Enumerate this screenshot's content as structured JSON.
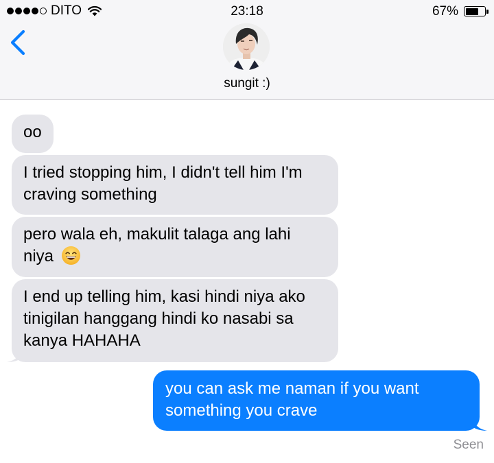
{
  "status_bar": {
    "carrier": "DITO",
    "time": "23:18",
    "battery_percent": "67%",
    "battery_level": 0.67,
    "signal_bars_filled": 4,
    "signal_bars_total": 5,
    "wifi_icon": "wifi-icon"
  },
  "header": {
    "back_icon": "chevron-left-icon",
    "contact_name": "sungit :)",
    "avatar_icon": "contact-avatar"
  },
  "messages": [
    {
      "direction": "incoming",
      "text": "oo"
    },
    {
      "direction": "incoming",
      "line1": "I tried stopping him, I didn't tell him I'm",
      "line2": "craving something"
    },
    {
      "direction": "incoming",
      "line1": "pero wala eh, makulit talaga ang lahi",
      "line2": "niya",
      "emoji": "grinning-face-with-smiling-eyes"
    },
    {
      "direction": "incoming",
      "line1": "I end up telling him, kasi hindi niya ako",
      "line2": "tinigilan hanggang hindi ko nasabi sa",
      "line3": "kanya HAHAHA"
    },
    {
      "direction": "outgoing",
      "line1": "you can ask me naman if you want",
      "line2": "something you crave"
    }
  ],
  "receipt": "Seen",
  "colors": {
    "incoming_bubble": "#e5e5ea",
    "outgoing_bubble": "#0b7fff",
    "accent": "#0b7fff",
    "header_bg": "#f6f6f8",
    "receipt_text": "#8e8e93"
  }
}
